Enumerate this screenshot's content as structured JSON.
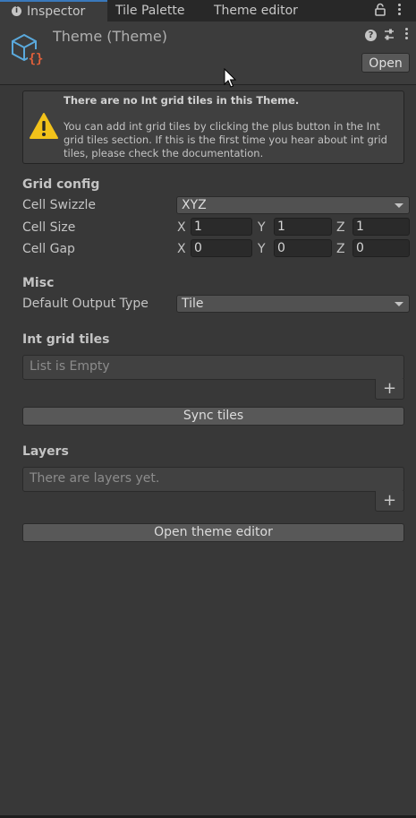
{
  "tabs": {
    "inspector": "Inspector",
    "tile_palette": "Tile Palette",
    "theme_editor": "Theme editor",
    "inspector_icon_glyph": "i"
  },
  "header": {
    "title": "Theme (Theme)",
    "open_label": "Open",
    "help_glyph": "?",
    "asset_icon_glyph": "{}"
  },
  "helpbox": {
    "title": "There are no Int grid tiles in this Theme.",
    "body": "You can add int grid tiles by clicking the plus button in the Int grid tiles section. If this is the first time you hear about int grid tiles, please check the documentation."
  },
  "grid_config": {
    "title": "Grid config",
    "cell_swizzle_label": "Cell Swizzle",
    "cell_swizzle_value": "XYZ",
    "cell_size_label": "Cell Size",
    "cell_size": {
      "x": "1",
      "y": "1",
      "z": "1"
    },
    "cell_gap_label": "Cell Gap",
    "cell_gap": {
      "x": "0",
      "y": "0",
      "z": "0"
    },
    "axis_x": "X",
    "axis_y": "Y",
    "axis_z": "Z"
  },
  "misc": {
    "title": "Misc",
    "output_type_label": "Default Output Type",
    "output_type_value": "Tile"
  },
  "int_grid": {
    "title": "Int grid tiles",
    "empty_text": "List is Empty",
    "add_glyph": "+",
    "sync_label": "Sync tiles"
  },
  "layers": {
    "title": "Layers",
    "empty_text": "There are layers yet.",
    "add_glyph": "+"
  },
  "open_editor_label": "Open theme editor",
  "colors": {
    "background": "#383838",
    "tab_accent": "#3a79bb",
    "asset_icon_cube": "#5aa9dc",
    "asset_icon_braces": "#e0603a",
    "warning": "#f2c21a"
  },
  "icons": {
    "inspector_tab": "info-icon",
    "lock": "lock-icon",
    "tab_menu": "kebab-menu-icon",
    "asset": "theme-asset-icon",
    "help": "help-icon",
    "settings": "preset-settings-icon",
    "header_menu": "kebab-menu-icon",
    "warning": "warning-icon",
    "dropdown": "chevron-down-icon",
    "add": "plus-icon",
    "cursor": "mouse-cursor-icon"
  }
}
